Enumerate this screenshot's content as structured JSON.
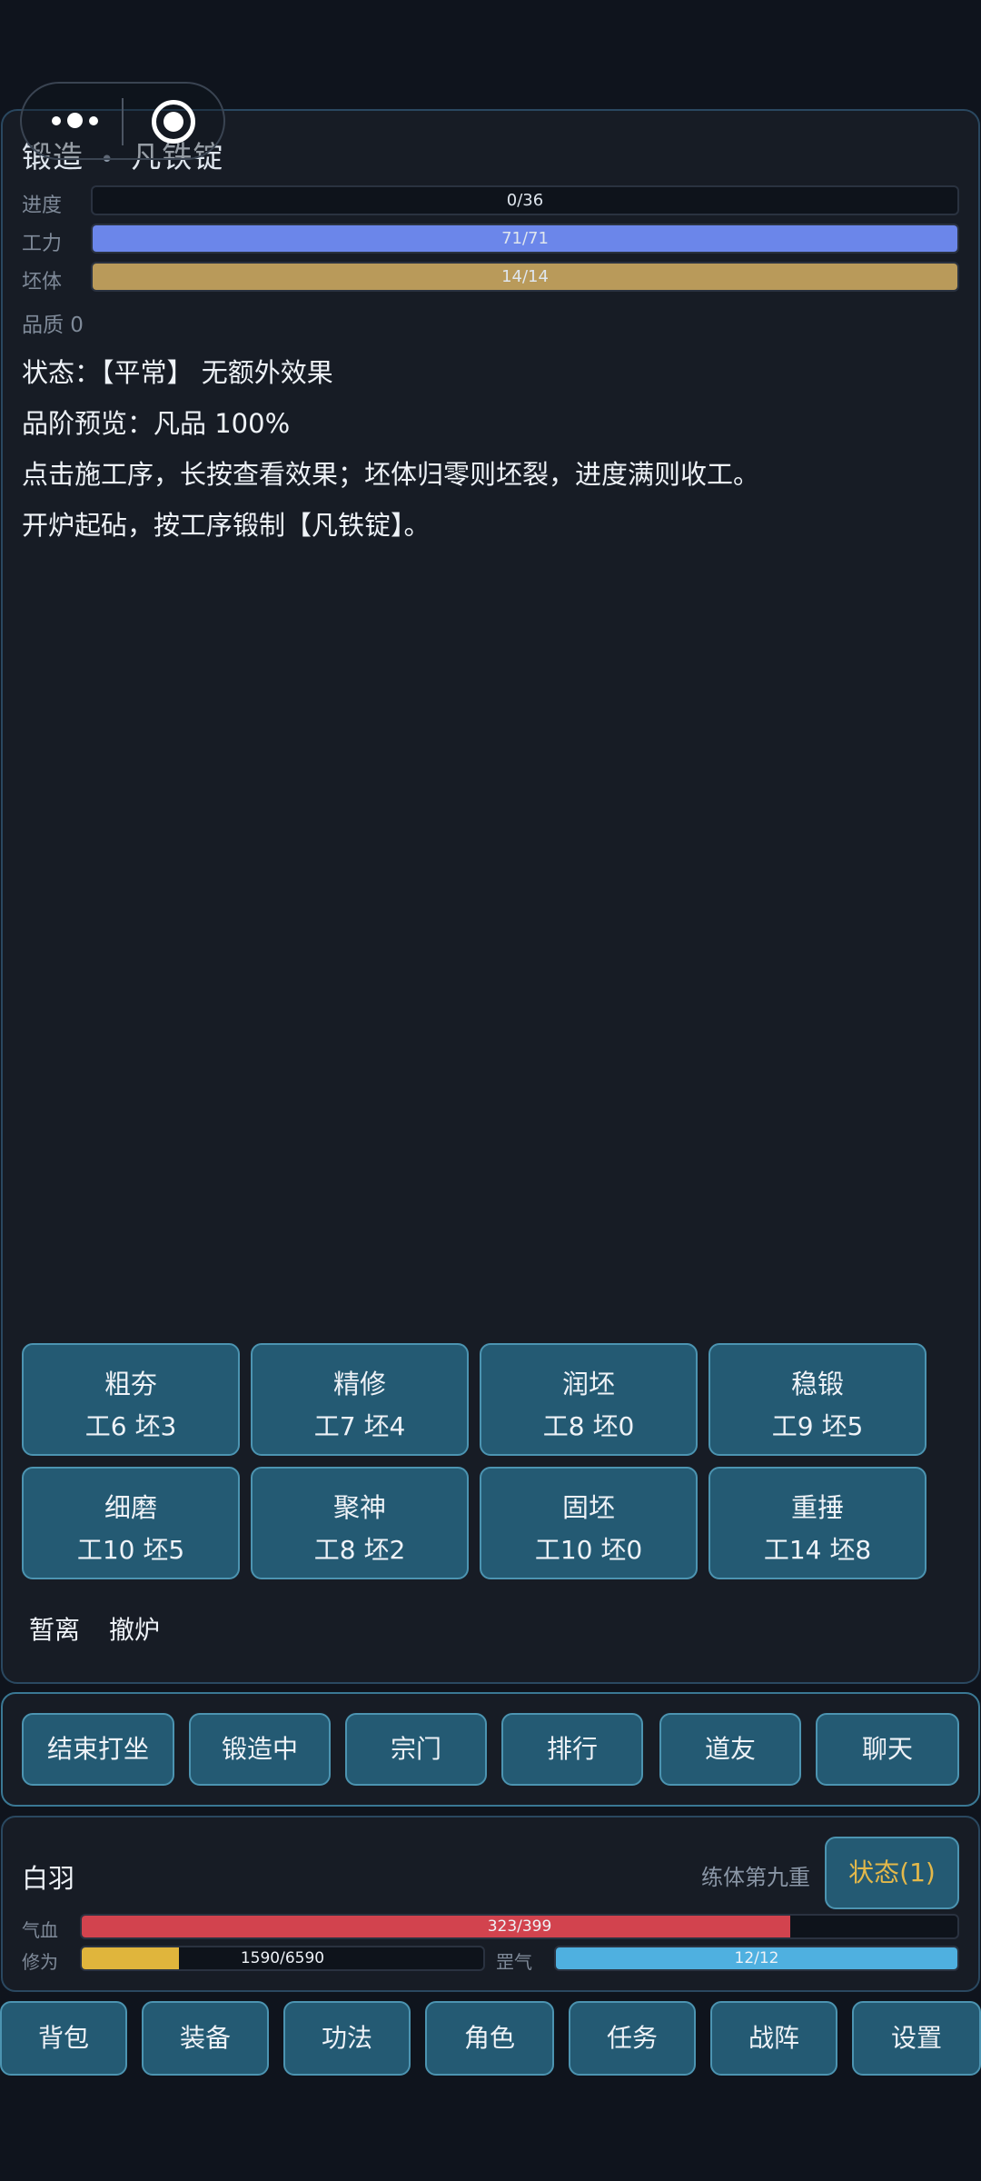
{
  "header": {
    "title_left": "锻造",
    "title_sep": "•",
    "title_right": "凡铁锭"
  },
  "progress_bars": [
    {
      "label": "进度",
      "text": "0/36",
      "fraction": 0,
      "color": "#3a4454"
    },
    {
      "label": "工力",
      "text": "71/71",
      "fraction": 1,
      "color": "#6b86ea"
    },
    {
      "label": "坯体",
      "text": "14/14",
      "fraction": 1,
      "color": "#b99a5a"
    }
  ],
  "quality": "品质 0",
  "info_lines": [
    "状态：【平常】 无额外效果",
    "品阶预览：凡品 100%",
    "点击施工序，长按查看效果；坯体归零则坯裂，进度满则收工。",
    "开炉起砧，按工序锻制【凡铁锭】。"
  ],
  "actions": [
    {
      "name": "粗夯",
      "cost": "工6 坯3"
    },
    {
      "name": "精修",
      "cost": "工7 坯4"
    },
    {
      "name": "润坯",
      "cost": "工8 坯0"
    },
    {
      "name": "稳锻",
      "cost": "工9 坯5"
    },
    {
      "name": "细磨",
      "cost": "工10 坯5"
    },
    {
      "name": "聚神",
      "cost": "工8 坯2"
    },
    {
      "name": "固坯",
      "cost": "工10 坯0"
    },
    {
      "name": "重捶",
      "cost": "工14 坯8"
    }
  ],
  "text_buttons": {
    "pause": "暂离",
    "withdraw": "撤炉"
  },
  "nav": [
    "结束打坐",
    "锻造中",
    "宗门",
    "排行",
    "道友",
    "聊天"
  ],
  "character": {
    "name": "白羽",
    "realm": "练体第九重",
    "state_button": "状态(1)",
    "hp": {
      "label": "气血",
      "text": "323/399",
      "fraction": 0.8095,
      "color": "#d2434e"
    },
    "cultivation": {
      "label": "修为",
      "text": "1590/6590",
      "fraction": 0.2413,
      "color": "#e0b53c"
    },
    "qi": {
      "label": "罡气",
      "text": "12/12",
      "fraction": 1,
      "color": "#4fb0e0"
    }
  },
  "tabs": [
    "背包",
    "装备",
    "功法",
    "角色",
    "任务",
    "战阵",
    "设置"
  ]
}
